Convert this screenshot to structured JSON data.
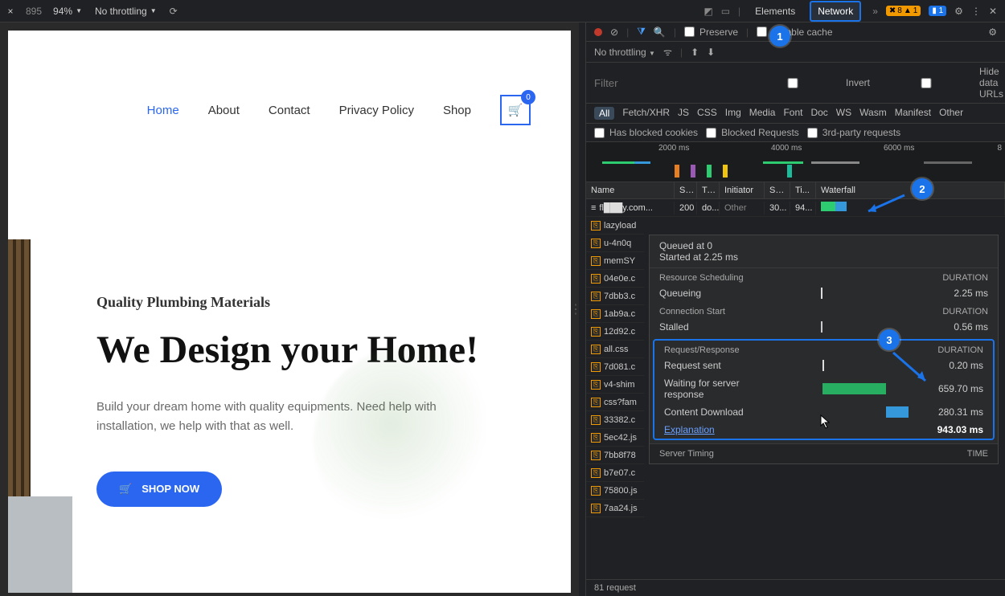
{
  "topbar": {
    "dim_value": "895",
    "zoom": "94%",
    "throttling": "No throttling",
    "tabs": {
      "elements": "Elements",
      "network": "Network"
    },
    "warnings": {
      "err": "8",
      "warn": "1"
    },
    "messages": "1"
  },
  "page": {
    "nav": {
      "home": "Home",
      "about": "About",
      "contact": "Contact",
      "privacy": "Privacy Policy",
      "shop": "Shop",
      "cart_count": "0"
    },
    "hero": {
      "pretitle": "Quality Plumbing Materials",
      "title": "We Design your Home!",
      "sub": "Build your dream home with quality equipments. Need help with installation, we help with that as well.",
      "cta": "SHOP NOW"
    }
  },
  "devtools": {
    "toolbar": {
      "preserve": "Preserve",
      "disable_cache": "Disable cache"
    },
    "throttle_row": {
      "label": "No throttling"
    },
    "filter": {
      "placeholder": "Filter",
      "invert": "Invert",
      "hide_urls": "Hide data URLs"
    },
    "types": [
      "All",
      "Fetch/XHR",
      "JS",
      "CSS",
      "Img",
      "Media",
      "Font",
      "Doc",
      "WS",
      "Wasm",
      "Manifest",
      "Other"
    ],
    "extra": {
      "blocked_cookies": "Has blocked cookies",
      "blocked_req": "Blocked Requests",
      "thirdparty": "3rd-party requests"
    },
    "overview_ticks": [
      "2000 ms",
      "4000 ms",
      "6000 ms",
      "8"
    ],
    "columns": {
      "name": "Name",
      "st": "St...",
      "ty": "Ty...",
      "init": "Initiator",
      "size": "Size",
      "ti": "Ti...",
      "wf": "Waterfall"
    },
    "first_row": {
      "name": "fl███y.com...",
      "status": "200",
      "type": "do...",
      "initiator": "Other",
      "size": "30...",
      "time": "94..."
    },
    "rows": [
      "lazyload",
      "u-4n0q",
      "memSY",
      "04e0e.c",
      "7dbb3.c",
      "1ab9a.c",
      "12d92.c",
      "all.css",
      "7d081.c",
      "v4-shim",
      "css?fam",
      "33382.c",
      "5ec42.js",
      "7bb8f78",
      "b7e07.c",
      "75800.js",
      "7aa24.js"
    ],
    "status": "81 request",
    "timing": {
      "queued": "Queued at 0",
      "started": "Started at 2.25 ms",
      "sched_hdr": "Resource Scheduling",
      "duration_hdr": "DURATION",
      "queueing": "Queueing",
      "queueing_val": "2.25 ms",
      "conn_hdr": "Connection Start",
      "stalled": "Stalled",
      "stalled_val": "0.56 ms",
      "rr_hdr": "Request/Response",
      "sent": "Request sent",
      "sent_val": "0.20 ms",
      "ttfb": "Waiting for server response",
      "ttfb_val": "659.70 ms",
      "dl": "Content Download",
      "dl_val": "280.31 ms",
      "explain": "Explanation",
      "total": "943.03 ms",
      "server_timing": "Server Timing",
      "time_hdr": "TIME"
    }
  },
  "callouts": {
    "c1": "1",
    "c2": "2",
    "c3": "3"
  }
}
